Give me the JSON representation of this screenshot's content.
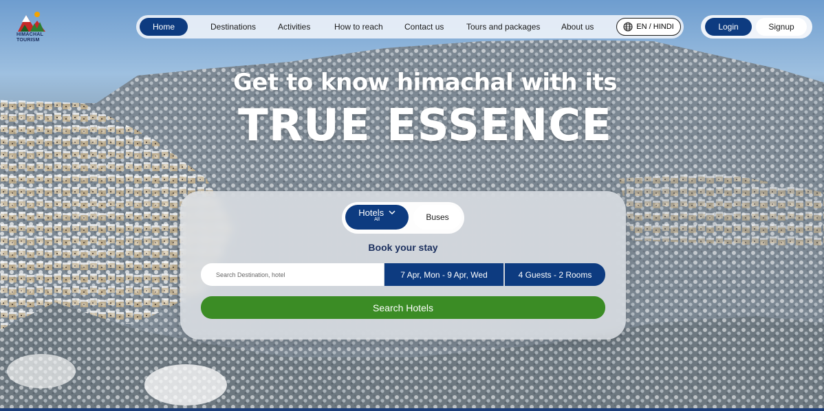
{
  "brand": {
    "logo_text_line1": "HIMACHAL",
    "logo_text_line2": "TOURISM"
  },
  "nav": {
    "items": [
      {
        "label": "Home",
        "active": true
      },
      {
        "label": "Destinations"
      },
      {
        "label": "Activities"
      },
      {
        "label": "How to reach"
      },
      {
        "label": "Contact us"
      },
      {
        "label": "Tours and packages"
      },
      {
        "label": "About us"
      }
    ],
    "language": "EN / HINDI",
    "language_icon": "globe-icon"
  },
  "auth": {
    "login": "Login",
    "signup": "Signup"
  },
  "hero": {
    "line1": "Get to know himachal with its",
    "line2": "TRUE ESSENCE"
  },
  "booking": {
    "tabs": {
      "hotels": "Hotels",
      "hotels_sub": "All",
      "buses": "Buses"
    },
    "title": "Book your stay",
    "search_placeholder": "Search Destination, hotel",
    "dates": "7 Apr, Mon - 9 Apr, Wed",
    "guests": "4 Guests - 2 Rooms",
    "search_button": "Search Hotels"
  },
  "colors": {
    "primary": "#0d3b80",
    "accent_green": "#3b8c25"
  }
}
